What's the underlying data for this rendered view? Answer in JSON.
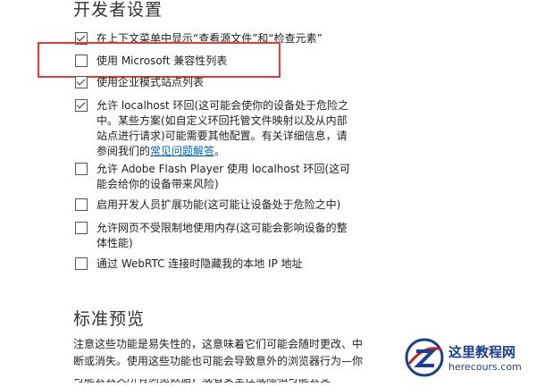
{
  "section_title": "开发者设置",
  "options": [
    {
      "label": "在上下文菜单中显示“查看源文件”和“检查元素”",
      "checked": true
    },
    {
      "label": "使用 Microsoft 兼容性列表",
      "checked": false
    },
    {
      "label": "使用企业模式站点列表",
      "checked": true
    },
    {
      "label": "允许 localhost 环回(这可能会使你的设备处于危险之中。某些方案(如自定义环回托管文件映射以及从内部站点进行请求)可能需要其他配置。有关详细信息，请参阅我们的",
      "link": "常见问题解答",
      "suffix": "。",
      "checked": true
    },
    {
      "label": "允许 Adobe Flash Player 使用 localhost 环回(这可能会给你的设备带来风险)",
      "checked": false
    },
    {
      "label": "启用开发人员扩展功能(这可能让设备处于危险之中)",
      "checked": false
    },
    {
      "label": "允许网页不受限制地使用内存(这可能会影响设备的整体性能)",
      "checked": false
    },
    {
      "label": "通过 WebRTC 连接时隐藏我的本地 IP 地址",
      "checked": false
    }
  ],
  "preview_title": "标准预览",
  "preview_note": "注意这些功能是易失性的，这意味着它们可能会随时更改、中断或消失。使用这些功能也可能会导致意外的浏览器行为—你可能会丢失所有浏览数据，或者安全性或隐私可能会受",
  "watermark": {
    "cn": "这里教程网",
    "en": "herecours.com"
  },
  "colors": {
    "highlight": "#e23b3b",
    "link": "#0067b8"
  }
}
